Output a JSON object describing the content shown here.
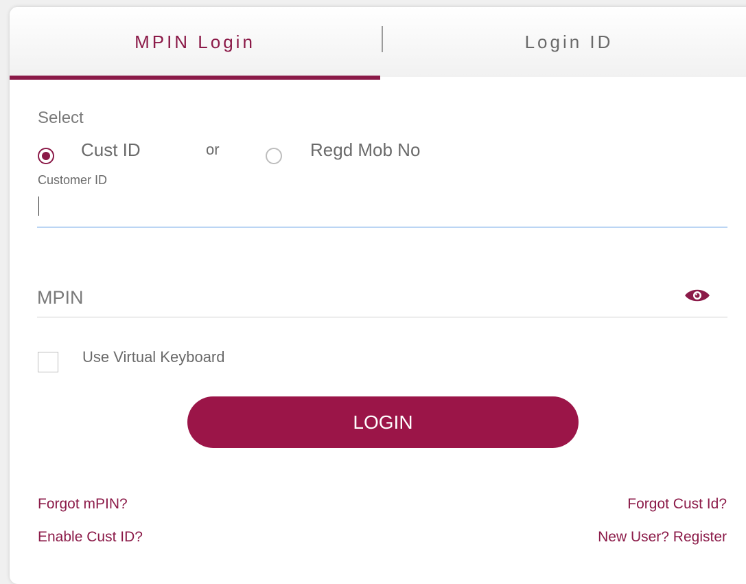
{
  "tabs": {
    "mpin_login": "MPIN Login",
    "login_id": "Login ID"
  },
  "form": {
    "select_label": "Select",
    "option_cust_id": "Cust ID",
    "or_text": "or",
    "option_mob": "Regd Mob No",
    "selected_option": "Cust ID",
    "customer_id_caption": "Customer ID",
    "customer_id_value": "",
    "mpin_placeholder": "MPIN",
    "mpin_value": "",
    "virtual_keyboard_label": "Use Virtual Keyboard",
    "virtual_keyboard_checked": false,
    "login_button": "LOGIN"
  },
  "links": {
    "forgot_mpin": "Forgot mPIN?",
    "enable_cust_id": "Enable Cust ID?",
    "forgot_cust_id": "Forgot Cust Id?",
    "new_user_register": "New User? Register"
  },
  "icons": {
    "show_password": "eye-icon"
  },
  "colors": {
    "brand": "#8b1a48",
    "button": "#9b1548",
    "input_focus": "#4a90e2"
  }
}
